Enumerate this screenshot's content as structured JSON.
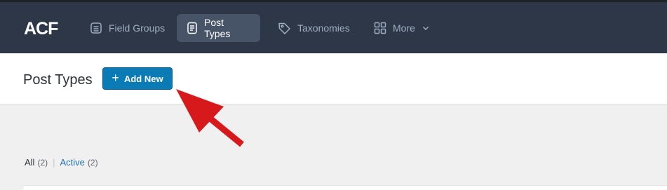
{
  "app": {
    "logo_text": "ACF"
  },
  "nav": {
    "items": [
      {
        "label": "Field Groups",
        "icon": "field-groups-icon",
        "active": false
      },
      {
        "label": "Post Types",
        "icon": "post-types-icon",
        "active": true
      },
      {
        "label": "Taxonomies",
        "icon": "tag-icon",
        "active": false
      },
      {
        "label": "More",
        "icon": "grid-icon",
        "active": false
      }
    ]
  },
  "header": {
    "title": "Post Types",
    "add_new_label": "Add New",
    "add_new_icon": "plus-icon"
  },
  "filters": {
    "all_label": "All",
    "all_count": "(2)",
    "separator": "|",
    "active_label": "Active",
    "active_count": "(2)"
  },
  "annotation": {
    "arrow_color": "#d7191c"
  },
  "colors": {
    "navbar": "#2d3748",
    "nav_active": "#475366",
    "button_primary": "#0a7bb4",
    "link": "#2271b1"
  }
}
